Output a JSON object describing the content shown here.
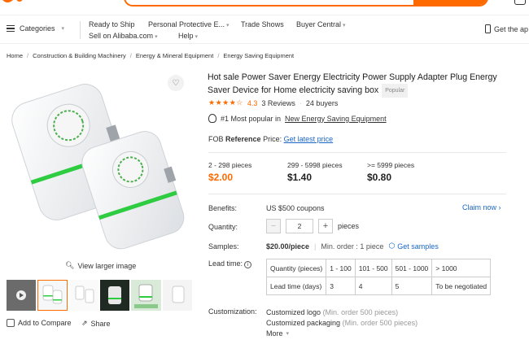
{
  "header": {
    "categories_label": "Categories",
    "nav_row1": [
      "Ready to Ship",
      "Personal Protective E...",
      "Trade Shows",
      "Buyer Central"
    ],
    "nav_row2": [
      "Sell on Alibaba.com",
      "Help"
    ],
    "get_app": "Get the ap"
  },
  "breadcrumb": [
    "Home",
    "Construction & Building Machinery",
    "Energy & Mineral Equipment",
    "Energy Saving Equipment"
  ],
  "gallery": {
    "view_larger": "View larger image",
    "add_to_compare": "Add to Compare",
    "share": "Share",
    "device_label": "electricity saving box"
  },
  "product": {
    "title": "Hot sale Power Saver Energy Electricity Power Supply Adapter Plug Energy Saver Device for Home electricity saving box",
    "badge": "Popular",
    "rating": "4.3",
    "reviews": "3 Reviews",
    "buyers": "24 buyers",
    "most_popular_prefix": "#1 Most popular in",
    "most_popular_category": "New Energy Saving Equipment",
    "fob_prefix": "FOB",
    "fob_bold": "Reference",
    "fob_suffix": "Price:",
    "fob_link": "Get latest price",
    "tiers": [
      {
        "qty": "2 - 298 pieces",
        "price": "$2.00"
      },
      {
        "qty": "299 - 5998 pieces",
        "price": "$1.40"
      },
      {
        "qty": ">= 5999 pieces",
        "price": "$0.80"
      }
    ],
    "benefits_label": "Benefits:",
    "benefits_value": "US $500 coupons",
    "claim_now": "Claim now",
    "quantity_label": "Quantity:",
    "quantity_value": "2",
    "quantity_unit": "pieces",
    "samples_label": "Samples:",
    "sample_price": "$20.00/piece",
    "sample_min": "Min. order : 1 piece",
    "get_samples": "Get samples",
    "lead_time_label": "Lead time:",
    "lead_table": {
      "row1": [
        "Quantity (pieces)",
        "1 - 100",
        "101 - 500",
        "501 - 1000",
        "> 1000"
      ],
      "row2": [
        "Lead time (days)",
        "3",
        "4",
        "5",
        "To be negotiated"
      ]
    },
    "customization_label": "Customization:",
    "customization": [
      {
        "name": "Customized logo",
        "min": "(Min. order 500 pieces)"
      },
      {
        "name": "Customized packaging",
        "min": "(Min. order 500 pieces)"
      }
    ],
    "more": "More"
  },
  "colors": {
    "accent": "#ff6a00",
    "link": "#1a66c7",
    "led": "#2ecc40"
  }
}
